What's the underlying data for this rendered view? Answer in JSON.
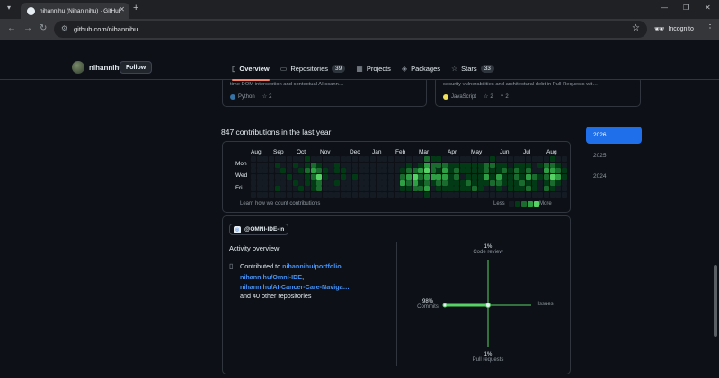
{
  "browser": {
    "tab_title": "nihannihu (Nihan nihu) · GitHub",
    "url": "github.com/nihannihu",
    "incognito_label": "Incognito"
  },
  "header": {
    "username": "nihannihu",
    "follow_label": "Follow",
    "nav": [
      {
        "label": "Overview",
        "icon": "book-icon",
        "active": true
      },
      {
        "label": "Repositories",
        "icon": "repo-icon",
        "count": "39"
      },
      {
        "label": "Projects",
        "icon": "table-icon"
      },
      {
        "label": "Packages",
        "icon": "package-icon"
      },
      {
        "label": "Stars",
        "icon": "star-icon",
        "count": "33"
      }
    ]
  },
  "cards": [
    {
      "description": "time DOM interception and contextual AI scann…",
      "language": "Python",
      "language_color": "#3572A5",
      "stars": "2"
    },
    {
      "description": "security vulnerabilities and architectural debt in Pull Requests wit…",
      "language": "JavaScript",
      "language_color": "#f1e05a",
      "stars": "2",
      "forks": "2"
    }
  ],
  "contributions": {
    "title": "847 contributions in the last year",
    "months": [
      "Aug",
      "Sep",
      "Oct",
      "Nov",
      "Dec",
      "Jan",
      "Feb",
      "Mar",
      "Apr",
      "May",
      "Jun",
      "Jul",
      "Aug"
    ],
    "days": [
      "Mon",
      "Wed",
      "Fri"
    ],
    "learn_link": "Learn how we count contributions",
    "legend_less": "Less",
    "legend_more": "More",
    "colors": [
      "#151b23",
      "#033a16",
      "#196c2e",
      "#2ea043",
      "#56d364"
    ],
    "grid": [
      [
        0,
        0,
        0,
        0,
        0,
        0,
        0
      ],
      [
        0,
        0,
        0,
        0,
        0,
        0,
        0
      ],
      [
        0,
        0,
        0,
        0,
        0,
        0,
        0
      ],
      [
        0,
        0,
        0,
        0,
        0,
        0,
        0
      ],
      [
        0,
        1,
        0,
        0,
        0,
        1,
        0
      ],
      [
        0,
        0,
        1,
        0,
        0,
        0,
        0
      ],
      [
        0,
        0,
        0,
        1,
        0,
        0,
        0
      ],
      [
        0,
        1,
        0,
        0,
        1,
        0,
        0
      ],
      [
        0,
        0,
        1,
        0,
        0,
        1,
        0
      ],
      [
        1,
        1,
        2,
        1,
        1,
        0,
        0
      ],
      [
        0,
        2,
        3,
        2,
        1,
        1,
        0
      ],
      [
        0,
        1,
        2,
        4,
        2,
        2,
        0
      ],
      [
        0,
        0,
        1,
        1,
        0,
        0,
        0
      ],
      [
        0,
        0,
        0,
        0,
        0,
        0,
        0
      ],
      [
        0,
        1,
        1,
        0,
        1,
        0,
        0
      ],
      [
        0,
        0,
        1,
        1,
        0,
        0,
        0
      ],
      [
        0,
        0,
        0,
        0,
        0,
        0,
        0
      ],
      [
        0,
        0,
        0,
        1,
        0,
        0,
        0
      ],
      [
        0,
        0,
        0,
        0,
        0,
        0,
        0
      ],
      [
        0,
        0,
        0,
        0,
        0,
        0,
        0
      ],
      [
        0,
        0,
        0,
        0,
        0,
        0,
        0
      ],
      [
        0,
        0,
        0,
        0,
        0,
        0,
        0
      ],
      [
        0,
        0,
        0,
        0,
        0,
        0,
        0
      ],
      [
        0,
        0,
        0,
        0,
        0,
        0,
        0
      ],
      [
        0,
        0,
        0,
        0,
        0,
        0,
        0
      ],
      [
        0,
        0,
        1,
        2,
        3,
        1,
        0
      ],
      [
        0,
        1,
        2,
        3,
        2,
        1,
        0
      ],
      [
        0,
        0,
        2,
        4,
        3,
        2,
        0
      ],
      [
        0,
        1,
        3,
        2,
        1,
        2,
        0
      ],
      [
        2,
        3,
        4,
        3,
        2,
        3,
        1
      ],
      [
        1,
        2,
        2,
        3,
        1,
        0,
        0
      ],
      [
        1,
        2,
        1,
        3,
        2,
        1,
        0
      ],
      [
        0,
        2,
        3,
        3,
        2,
        1,
        0
      ],
      [
        0,
        1,
        1,
        1,
        1,
        1,
        0
      ],
      [
        0,
        1,
        2,
        2,
        1,
        1,
        0
      ],
      [
        0,
        1,
        1,
        0,
        1,
        1,
        0
      ],
      [
        0,
        1,
        1,
        1,
        2,
        1,
        0
      ],
      [
        0,
        1,
        1,
        1,
        1,
        2,
        0
      ],
      [
        0,
        1,
        1,
        1,
        1,
        1,
        0
      ],
      [
        0,
        2,
        2,
        3,
        1,
        0,
        0
      ],
      [
        1,
        2,
        1,
        1,
        2,
        0,
        0
      ],
      [
        0,
        1,
        1,
        3,
        2,
        1,
        0
      ],
      [
        0,
        1,
        2,
        1,
        1,
        0,
        0
      ],
      [
        0,
        0,
        1,
        1,
        1,
        1,
        0
      ],
      [
        0,
        1,
        2,
        2,
        1,
        1,
        0
      ],
      [
        0,
        1,
        1,
        1,
        2,
        1,
        0
      ],
      [
        0,
        1,
        2,
        3,
        1,
        2,
        0
      ],
      [
        0,
        0,
        0,
        2,
        1,
        1,
        0
      ],
      [
        0,
        1,
        0,
        1,
        0,
        0,
        0
      ],
      [
        0,
        2,
        3,
        2,
        1,
        2,
        0
      ],
      [
        1,
        2,
        3,
        4,
        2,
        1,
        0
      ],
      [
        0,
        1,
        2,
        3,
        1,
        0,
        0
      ],
      [
        0,
        0,
        1,
        1,
        0,
        0,
        0
      ]
    ]
  },
  "years": [
    "2026",
    "2025",
    "2024"
  ],
  "activity": {
    "org": "@OMNI-IDE-in",
    "title": "Activity overview",
    "contributed_to_prefix": "Contributed to ",
    "repos": [
      "nihannihu/portfolio",
      "nihannihu/Omni-IDE",
      "nihannihu/AI-Cancer-Care-Naviga…"
    ],
    "others": "and 40 other repositories",
    "axes": {
      "code_review": {
        "label": "Code review",
        "pct": "1%"
      },
      "issues": {
        "label": "Issues",
        "pct": ""
      },
      "pull_requests": {
        "label": "Pull requests",
        "pct": "1%"
      },
      "commits": {
        "label": "Commits",
        "pct": "98%"
      }
    }
  }
}
